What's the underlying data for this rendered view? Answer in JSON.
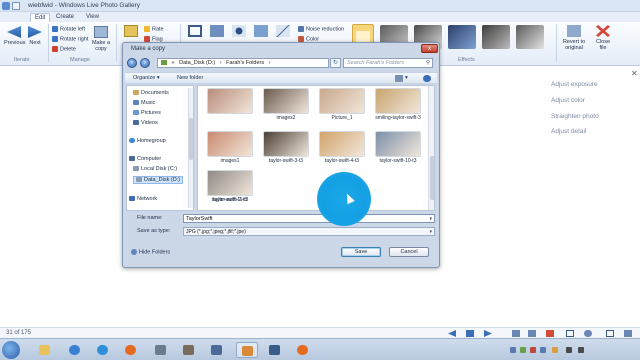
{
  "window": {
    "title": "wiebfwid - Windows Live Photo Gallery"
  },
  "ribbon": {
    "tabs": [
      "Edit",
      "Create",
      "View"
    ],
    "buttons": {
      "previous": "Previous",
      "next": "Next",
      "rotate_left": "Rotate left",
      "rotate_right": "Rotate right",
      "delete": "Delete",
      "make_copy": "Make a copy",
      "rate": "Rate",
      "flag": "Flag",
      "noise_reduction": "Noise reduction",
      "color": "Color",
      "revert": "Revert to original",
      "close_file": "Close file"
    },
    "groups": {
      "iterate": "Iterate",
      "manage": "Manage",
      "effects": "Effects"
    }
  },
  "right_panel": {
    "items": [
      "Adjust exposure",
      "Adjust color",
      "Straighten photo",
      "Adjust detail"
    ]
  },
  "dialog": {
    "title": "Make a copy",
    "close_label": "x",
    "address_crumbs": [
      "Data_Disk (D:)",
      "Farah's Folders"
    ],
    "search_placeholder": "Search Farah's Folders",
    "commands": {
      "organize": "Organize",
      "new_folder": "New folder"
    },
    "nav_items": {
      "documents": "Documents",
      "music": "Music",
      "pictures": "Pictures",
      "videos": "Videos",
      "homegroup": "Homegroup",
      "computer": "Computer",
      "local_disk": "Local Disk (C:)",
      "data_disk": "Data_Disk (D:)",
      "network": "Network"
    },
    "files": [
      {
        "label": "",
        "color": "#b98d7a"
      },
      {
        "label": "images2",
        "color": "#6b5a4e"
      },
      {
        "label": "Picture_1",
        "color": "#c9a88c"
      },
      {
        "label": "smiling-taylor-swift-3",
        "color": "#c8a46e"
      },
      {
        "label": "images1",
        "color": "#c98a6f"
      },
      {
        "label": "taylor-swift-3-t3",
        "color": "#4b3f36"
      },
      {
        "label": "taylor-swift-4-t3",
        "color": "#d2a46a"
      },
      {
        "label": "taylor-swift-10-t3",
        "color": "#7c8faa"
      },
      {
        "label": "taylor-swift-2-t3",
        "color": "#b33a37"
      },
      {
        "label": "taylor-swift-11-t3",
        "color": "#8f8a86"
      }
    ],
    "file_name_label": "File name:",
    "file_name_value": "TaylorSwift",
    "save_type_label": "Save as type:",
    "save_type_value": "JPG (*.jpg;*.jpeg;*.jfif;*.jpe)",
    "hide_folders": "Hide Folders",
    "save_button": "Save",
    "cancel_button": "Cancel"
  },
  "status": {
    "count": "31 of 175"
  },
  "taskbar": {
    "clock_time": "",
    "clock_date": ""
  }
}
